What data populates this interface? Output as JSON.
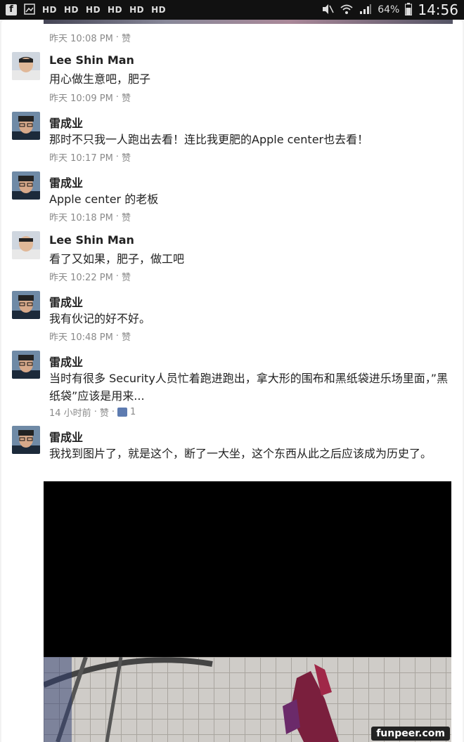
{
  "status_bar": {
    "hd_labels": [
      "HD",
      "HD",
      "HD",
      "HD",
      "HD",
      "HD"
    ],
    "battery": "64%",
    "time": "14:56",
    "icons": [
      "facebook-icon",
      "gallery-icon",
      "mute-icon",
      "wifi-icon",
      "signal-icon",
      "battery-icon"
    ]
  },
  "comments": [
    {
      "name": "",
      "text": "",
      "time": "昨天 10:08 PM",
      "like": "赞"
    },
    {
      "name": "Lee Shin Man",
      "text": "用心做生意吧，肥子",
      "time": "昨天 10:09 PM",
      "like": "赞"
    },
    {
      "name": "雷成业",
      "text": "那时不只我一人跑出去看！连比我更肥的Apple center也去看！",
      "time": "昨天 10:17 PM",
      "like": "赞"
    },
    {
      "name": "雷成业",
      "text": "Apple center 的老板",
      "time": "昨天 10:18 PM",
      "like": "赞"
    },
    {
      "name": "Lee Shin Man",
      "text": "看了又如果，肥子，做工吧",
      "time": "昨天 10:22 PM",
      "like": "赞"
    },
    {
      "name": "雷成业",
      "text": "我有伙记的好不好。",
      "time": "昨天 10:48 PM",
      "like": "赞"
    },
    {
      "name": "雷成业",
      "text": "当时有很多 Security人员忙着跑进跑出，拿大形的围布和黑纸袋进乐场里面，”黑纸袋”应该是用来...",
      "time": "14 小时前",
      "like": "赞",
      "like_count": "1"
    },
    {
      "name": "雷成业",
      "text": "我找到图片了，就是这个，断了一大坐，这个东西从此之后应该成为历史了。",
      "time": "",
      "like": ""
    }
  ],
  "watermark": "funpeer.com",
  "colors": {
    "status_bar_bg": "#111111",
    "card_bg": "#ffffff",
    "meta_text": "#8a8a8a",
    "like_thumb": "#5d7bb0"
  }
}
